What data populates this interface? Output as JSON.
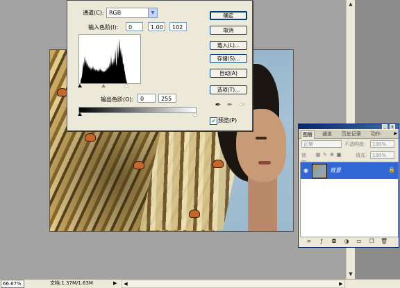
{
  "status_bar": {
    "zoom": "66.67%",
    "doc_info": "文档:1.37M/1.63M",
    "doc_arrow": "▶"
  },
  "levels_dialog": {
    "channel_label": "通道(C):",
    "channel_value": "RGB",
    "input_levels_label": "输入色阶(I):",
    "input_black": "0",
    "input_gamma": "1.00",
    "input_white": "102",
    "output_levels_label": "输出色阶(O):",
    "output_black": "0",
    "output_white": "255",
    "buttons": {
      "ok": "确定",
      "cancel": "取消",
      "load": "载入(L)...",
      "save": "存储(S)...",
      "auto": "自动(A)",
      "options": "选项(T)..."
    },
    "preview_label": "预览(P)",
    "preview_checked": true
  },
  "layers_panel": {
    "tabs": [
      "图层",
      "通道",
      "历史记录",
      "动作"
    ],
    "blend_mode": "正常",
    "opacity_label": "不透明度:",
    "opacity_value": "100%",
    "lock_label": "锁定:",
    "fill_label": "填充:",
    "fill_value": "100%",
    "layers": [
      {
        "name": "背景",
        "visible": true,
        "locked": true,
        "selected": true
      }
    ]
  },
  "icons": {
    "eye": "eye-icon",
    "lock": "lock-icon",
    "eyedropper": "eyedropper-icon"
  },
  "colors": {
    "selection": "#3168d5",
    "title_bar": "#0a246a",
    "dialog_bg": "#ece9d8"
  }
}
